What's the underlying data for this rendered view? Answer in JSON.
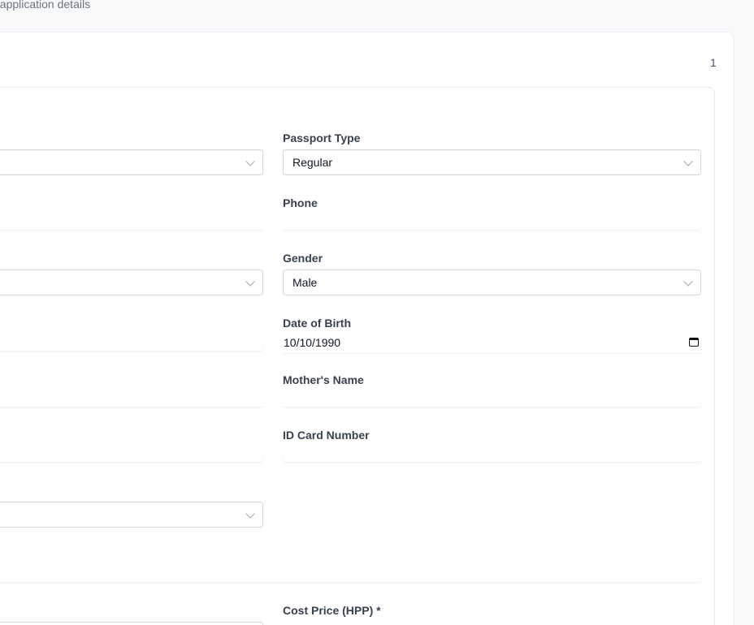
{
  "header": {
    "subtitle": "t application details",
    "step_count": "1"
  },
  "form": {
    "passport_type": {
      "label": "Passport Type",
      "value": "Regular"
    },
    "phone": {
      "label": "Phone",
      "value": ""
    },
    "gender": {
      "label": "Gender",
      "value": "Male"
    },
    "date_of_birth": {
      "label": "Date of Birth",
      "value": "10/10/1990"
    },
    "mothers_name": {
      "label": "Mother's Name",
      "value": ""
    },
    "id_card_number": {
      "label": "ID Card Number",
      "value": ""
    },
    "cost_price": {
      "label": "Cost Price (HPP) *"
    }
  }
}
